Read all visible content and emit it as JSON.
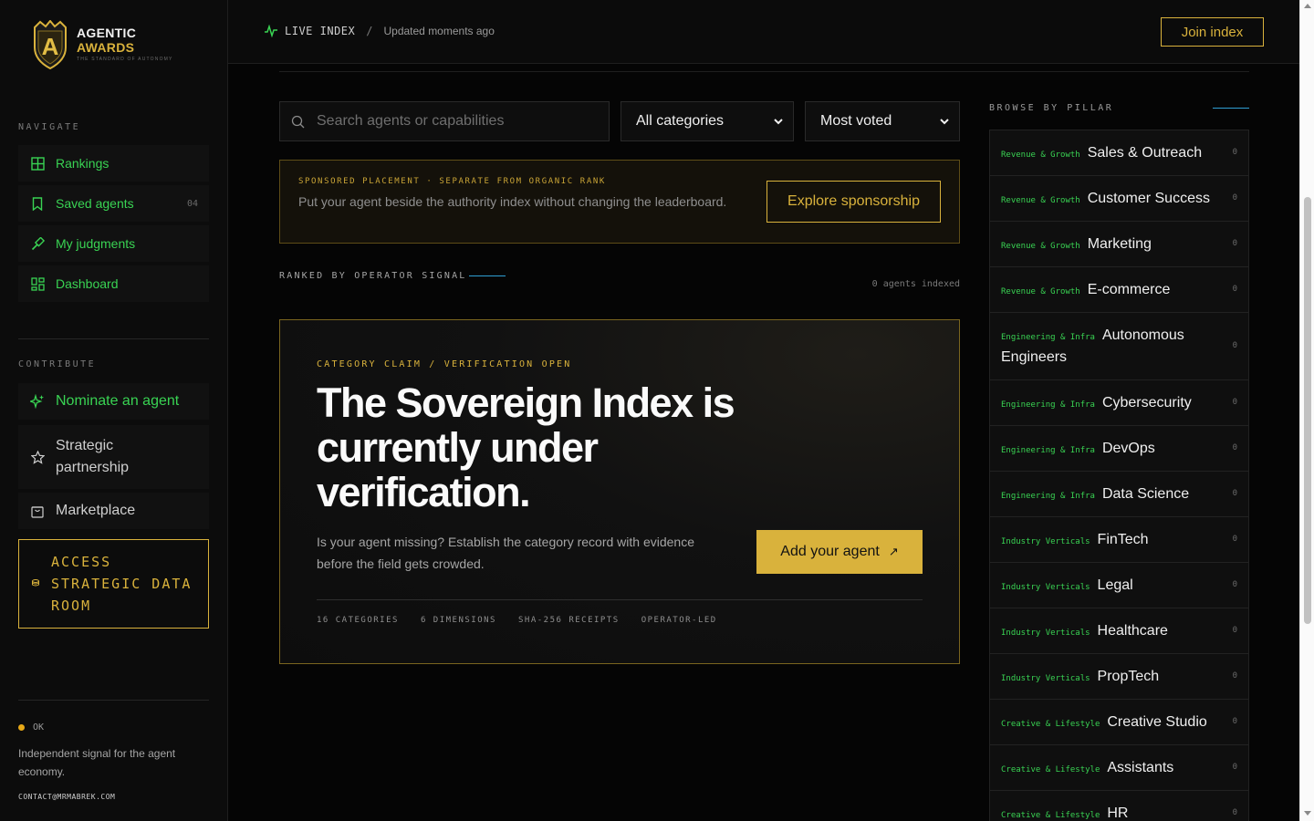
{
  "brand": {
    "line1": "AGENTIC",
    "line2": "AWARDS",
    "tagline": "THE STANDARD OF AUTONOMY",
    "logo_letter": "A",
    "accent": "#d9b23c",
    "green": "#39d353"
  },
  "sidebar": {
    "navigate_label": "NAVIGATE",
    "nav": [
      {
        "label": "Rankings",
        "icon": "grid-icon"
      },
      {
        "label": "Saved agents",
        "icon": "bookmark-icon",
        "count": "04"
      },
      {
        "label": "My judgments",
        "icon": "gavel-icon"
      },
      {
        "label": "Dashboard",
        "icon": "dashboard-icon"
      }
    ],
    "contribute_label": "CONTRIBUTE",
    "contribute": [
      {
        "label": "Nominate an agent",
        "icon": "sparkle-icon"
      },
      {
        "label": "Strategic partnership",
        "icon": "star-icon"
      },
      {
        "label": "Marketplace",
        "icon": "shopping-bag-icon"
      }
    ],
    "data_room": {
      "label": "ACCESS STRATEGIC DATA ROOM",
      "icon": "database-icon"
    },
    "status": "OK",
    "description": "Independent signal for the agent economy.",
    "contact": "CONTACT@MRMABREK.COM"
  },
  "topbar": {
    "live_label": "LIVE INDEX",
    "separator": "/",
    "updated": "Updated moments ago",
    "join_label": "Join index"
  },
  "filters": {
    "search_placeholder": "Search agents or capabilities",
    "category_selected": "All categories",
    "sort_selected": "Most voted"
  },
  "sponsored": {
    "kicker": "SPONSORED PLACEMENT · SEPARATE FROM ORGANIC RANK",
    "description": "Put your agent beside the authority index without changing the leaderboard.",
    "button": "Explore sponsorship"
  },
  "ranked": {
    "label": "RANKED BY OPERATOR SIGNAL",
    "indexed": "0 agents indexed"
  },
  "hero": {
    "kicker": "CATEGORY CLAIM / VERIFICATION OPEN",
    "title": "The Sovereign Index is currently under verification.",
    "description": "Is your agent missing? Establish the category record with evidence before the field gets crowded.",
    "button": "Add your agent",
    "button_icon": "↗",
    "stats": [
      "16 CATEGORIES",
      "6 DIMENSIONS",
      "SHA-256 RECEIPTS",
      "OPERATOR-LED"
    ]
  },
  "browse": {
    "label": "BROWSE BY PILLAR",
    "pillars": [
      {
        "group": "Revenue & Growth",
        "name": "Sales & Outreach",
        "count": "0"
      },
      {
        "group": "Revenue & Growth",
        "name": "Customer Success",
        "count": "0"
      },
      {
        "group": "Revenue & Growth",
        "name": "Marketing",
        "count": "0"
      },
      {
        "group": "Revenue & Growth",
        "name": "E-commerce",
        "count": "0"
      },
      {
        "group": "Engineering & Infra",
        "name": "Autonomous Engineers",
        "count": "0"
      },
      {
        "group": "Engineering & Infra",
        "name": "Cybersecurity",
        "count": "0"
      },
      {
        "group": "Engineering & Infra",
        "name": "DevOps",
        "count": "0"
      },
      {
        "group": "Engineering & Infra",
        "name": "Data Science",
        "count": "0"
      },
      {
        "group": "Industry Verticals",
        "name": "FinTech",
        "count": "0"
      },
      {
        "group": "Industry Verticals",
        "name": "Legal",
        "count": "0"
      },
      {
        "group": "Industry Verticals",
        "name": "Healthcare",
        "count": "0"
      },
      {
        "group": "Industry Verticals",
        "name": "PropTech",
        "count": "0"
      },
      {
        "group": "Creative & Lifestyle",
        "name": "Creative Studio",
        "count": "0"
      },
      {
        "group": "Creative & Lifestyle",
        "name": "Assistants",
        "count": "0"
      },
      {
        "group": "Creative & Lifestyle",
        "name": "HR",
        "count": "0"
      }
    ]
  }
}
